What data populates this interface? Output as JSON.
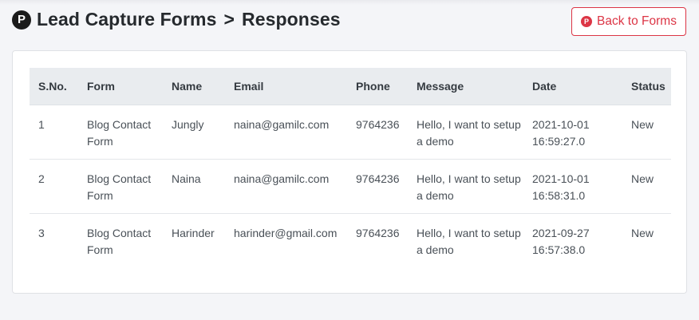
{
  "header": {
    "logo_letter": "P",
    "title_part1": "Lead Capture Forms",
    "separator": ">",
    "title_part2": "Responses"
  },
  "back_button": {
    "icon_letter": "P",
    "label": "Back to Forms"
  },
  "colors": {
    "accent": "#dc3545",
    "header_bg": "#e9ecef",
    "page_bg": "#f4f5f8"
  },
  "table": {
    "columns": [
      "S.No.",
      "Form",
      "Name",
      "Email",
      "Phone",
      "Message",
      "Date",
      "Status"
    ],
    "rows": [
      {
        "sno": "1",
        "form": "Blog Contact Form",
        "name": "Jungly",
        "email": "naina@gamilc.com",
        "phone": "9764236",
        "message": "Hello, I want to setup a demo",
        "date": "2021-10-01 16:59:27.0",
        "status": "New"
      },
      {
        "sno": "2",
        "form": "Blog Contact Form",
        "name": "Naina",
        "email": "naina@gamilc.com",
        "phone": "9764236",
        "message": "Hello, I want to setup a demo",
        "date": "2021-10-01 16:58:31.0",
        "status": "New"
      },
      {
        "sno": "3",
        "form": "Blog Contact Form",
        "name": "Harinder",
        "email": "harinder@gmail.com",
        "phone": "9764236",
        "message": "Hello, I want to setup a demo",
        "date": "2021-09-27 16:57:38.0",
        "status": "New"
      }
    ]
  }
}
